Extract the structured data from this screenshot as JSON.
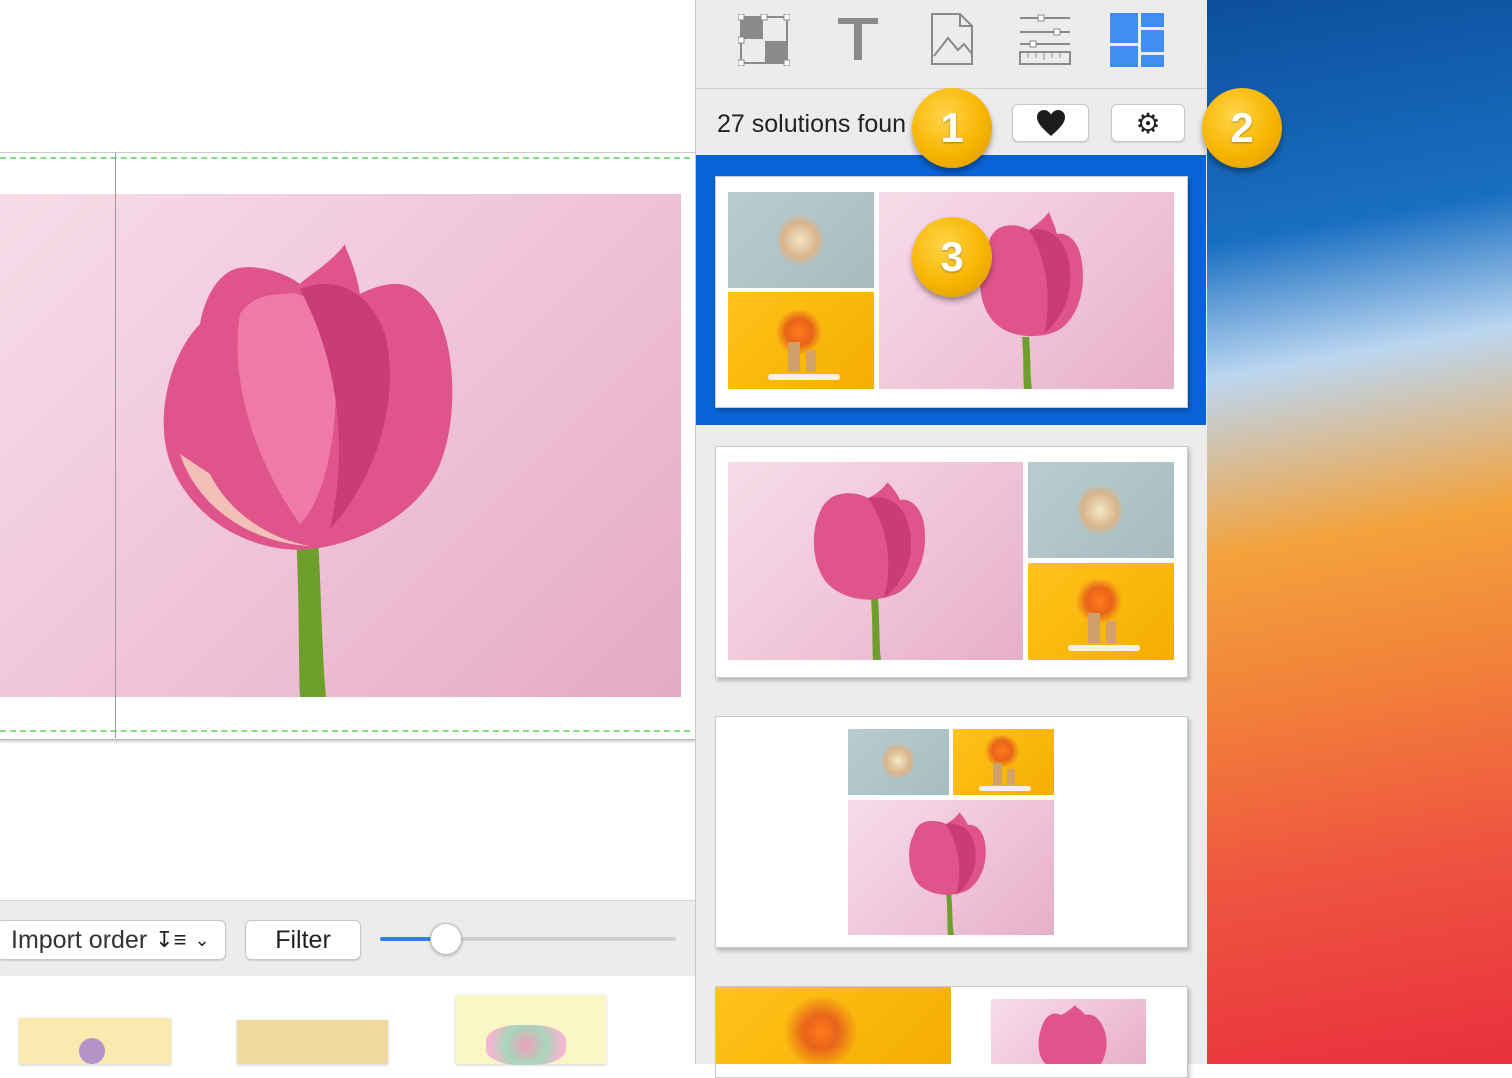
{
  "panel": {
    "toolbar_icons": [
      "select-grid-icon",
      "text-icon",
      "image-icon",
      "adjust-ruler-icon",
      "layout-icon"
    ],
    "solutions_text": "27 solutions foun",
    "favorite_icon": "heart-icon",
    "settings_icon": "gear-icon",
    "callouts": [
      "1",
      "2",
      "3"
    ],
    "accent_color": "#0a63d6"
  },
  "bottom_bar": {
    "sort_label": "Import order",
    "filter_label": "Filter",
    "zoom_fraction": 0.22
  }
}
